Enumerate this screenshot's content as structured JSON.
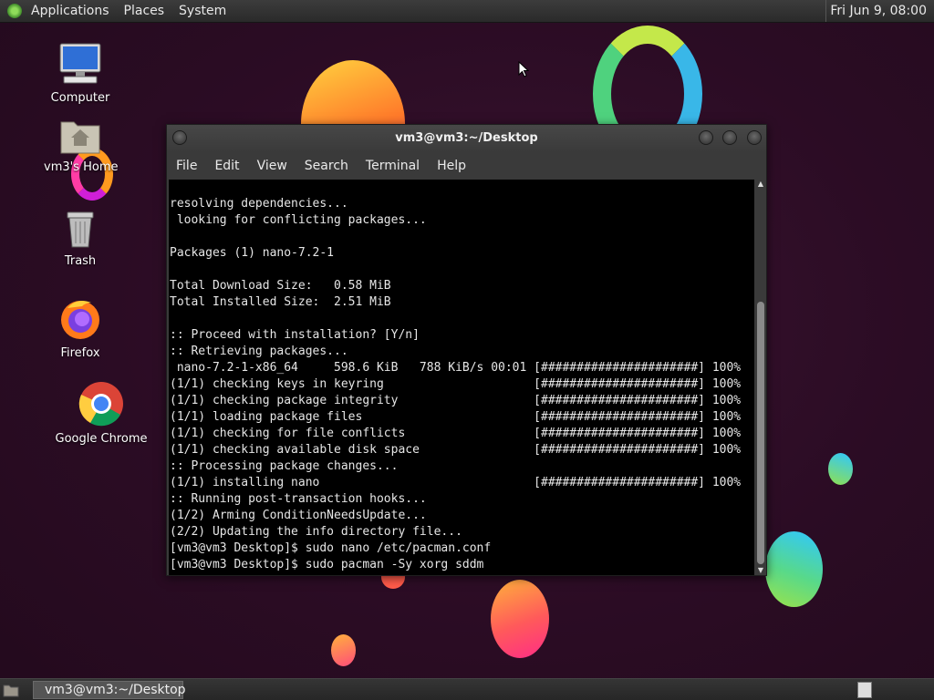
{
  "top_panel": {
    "menus": [
      "Applications",
      "Places",
      "System"
    ],
    "clock": "Fri Jun  9, 08:00"
  },
  "desktop_icons": [
    {
      "label": "Computer",
      "icon": "computer-icon"
    },
    {
      "label": "vm3's Home",
      "icon": "home-folder-icon"
    },
    {
      "label": "Trash",
      "icon": "trash-icon"
    },
    {
      "label": "Firefox",
      "icon": "firefox-icon"
    },
    {
      "label": "Google Chrome",
      "icon": "chrome-icon"
    }
  ],
  "window": {
    "title": "vm3@vm3:~/Desktop",
    "menu": [
      "File",
      "Edit",
      "View",
      "Search",
      "Terminal",
      "Help"
    ],
    "terminal_lines": [
      "resolving dependencies...",
      " looking for conflicting packages...",
      "",
      "Packages (1) nano-7.2-1",
      "",
      "Total Download Size:   0.58 MiB",
      "Total Installed Size:  2.51 MiB",
      "",
      ":: Proceed with installation? [Y/n]",
      ":: Retrieving packages...",
      " nano-7.2-1-x86_64     598.6 KiB   788 KiB/s 00:01 [######################] 100%",
      "(1/1) checking keys in keyring                     [######################] 100%",
      "(1/1) checking package integrity                   [######################] 100%",
      "(1/1) loading package files                        [######################] 100%",
      "(1/1) checking for file conflicts                  [######################] 100%",
      "(1/1) checking available disk space                [######################] 100%",
      ":: Processing package changes...",
      "(1/1) installing nano                              [######################] 100%",
      ":: Running post-transaction hooks...",
      "(1/2) Arming ConditionNeedsUpdate...",
      "(2/2) Updating the info directory file...",
      "[vm3@vm3 Desktop]$ sudo nano /etc/pacman.conf",
      "[vm3@vm3 Desktop]$ sudo pacman -Sy xorg sddm"
    ]
  },
  "taskbar": {
    "task_label": "vm3@vm3:~/Desktop"
  },
  "colors": {
    "desktop_bg": "#2b0c24",
    "panel_bg": "#2f2f2f",
    "terminal_bg": "#000000",
    "terminal_fg": "#e6e6e6"
  }
}
